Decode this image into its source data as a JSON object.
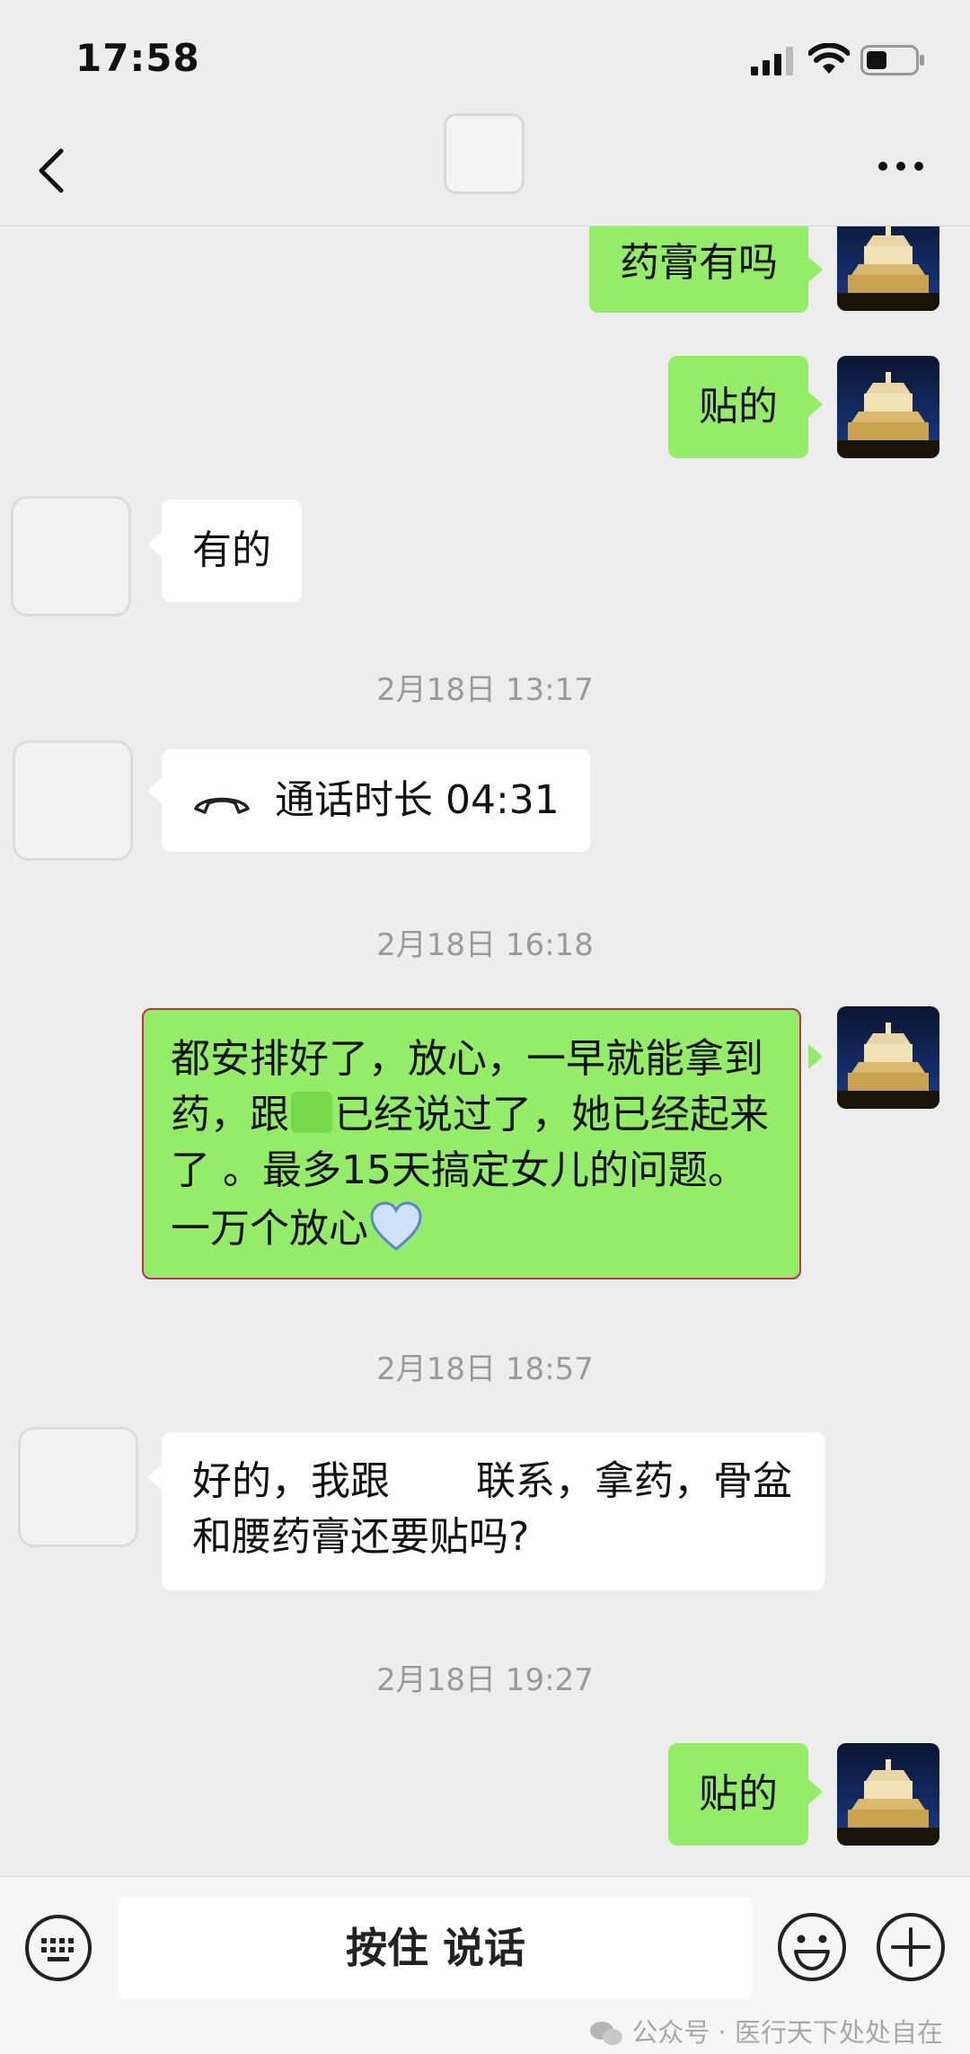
{
  "status_bar": {
    "time": "17:58"
  },
  "chat": {
    "messages": [
      {
        "text": "药膏有吗"
      },
      {
        "text": "贴的"
      },
      {
        "text": "有的"
      },
      {
        "timestamp": "2月18日 13:17"
      },
      {
        "text": "通话时长 04:31"
      },
      {
        "timestamp": "2月18日 16:18"
      },
      {
        "part1": "都安排好了，放心，一早就能拿到药，跟",
        "part2": "已经说过了，她已经起来了 。最多15天搞定女儿的问题。一万个放心"
      },
      {
        "timestamp": "2月18日 18:57"
      },
      {
        "part1": "好的，我跟",
        "part2": "联系，拿药，骨盆和腰药膏还要贴吗?"
      },
      {
        "timestamp": "2月18日 19:27"
      },
      {
        "text": "贴的"
      }
    ]
  },
  "bottom_bar": {
    "voice_label": "按住 说话"
  },
  "watermark": {
    "text": "公众号 · 医行天下处处自在"
  },
  "colors": {
    "self_bubble": "#95ec69",
    "other_bubble": "#ffffff",
    "background": "#ededed"
  }
}
